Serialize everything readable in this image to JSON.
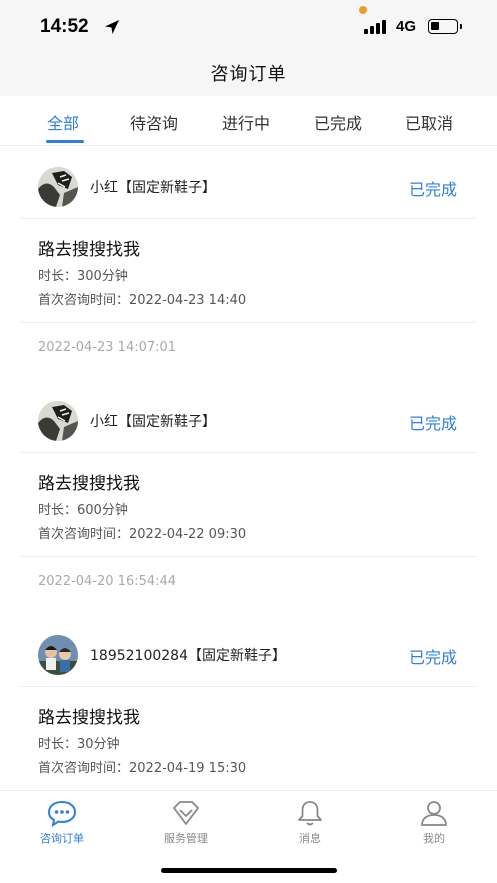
{
  "status_bar": {
    "time": "14:52",
    "network": "4G"
  },
  "nav": {
    "title": "咨询订单"
  },
  "tabs": [
    {
      "label": "全部",
      "active": true
    },
    {
      "label": "待咨询",
      "active": false
    },
    {
      "label": "进行中",
      "active": false
    },
    {
      "label": "已完成",
      "active": false
    },
    {
      "label": "已取消",
      "active": false
    }
  ],
  "orders": [
    {
      "name": "小红【固定新鞋子】",
      "status": "已完成",
      "title": "路去搜搜找我",
      "duration": "时长：300分钟",
      "first_time": "首次咨询时间：2022-04-23 14:40",
      "created": "2022-04-23 14:07:01"
    },
    {
      "name": "小红【固定新鞋子】",
      "status": "已完成",
      "title": "路去搜搜找我",
      "duration": "时长：600分钟",
      "first_time": "首次咨询时间：2022-04-22 09:30",
      "created": "2022-04-20 16:54:44"
    },
    {
      "name": "18952100284【固定新鞋子】",
      "status": "已完成",
      "title": "路去搜搜找我",
      "duration": "时长：30分钟",
      "first_time": "首次咨询时间：2022-04-19 15:30",
      "created": ""
    }
  ],
  "tabbar": [
    {
      "label": "咨询订单",
      "icon": "chat-icon",
      "active": true
    },
    {
      "label": "服务管理",
      "icon": "diamond-icon",
      "active": false
    },
    {
      "label": "消息",
      "icon": "bell-icon",
      "active": false
    },
    {
      "label": "我的",
      "icon": "user-icon",
      "active": false
    }
  ],
  "colors": {
    "accent": "#2f7fe0",
    "muted": "#888888",
    "divider": "#f0f0f0"
  }
}
